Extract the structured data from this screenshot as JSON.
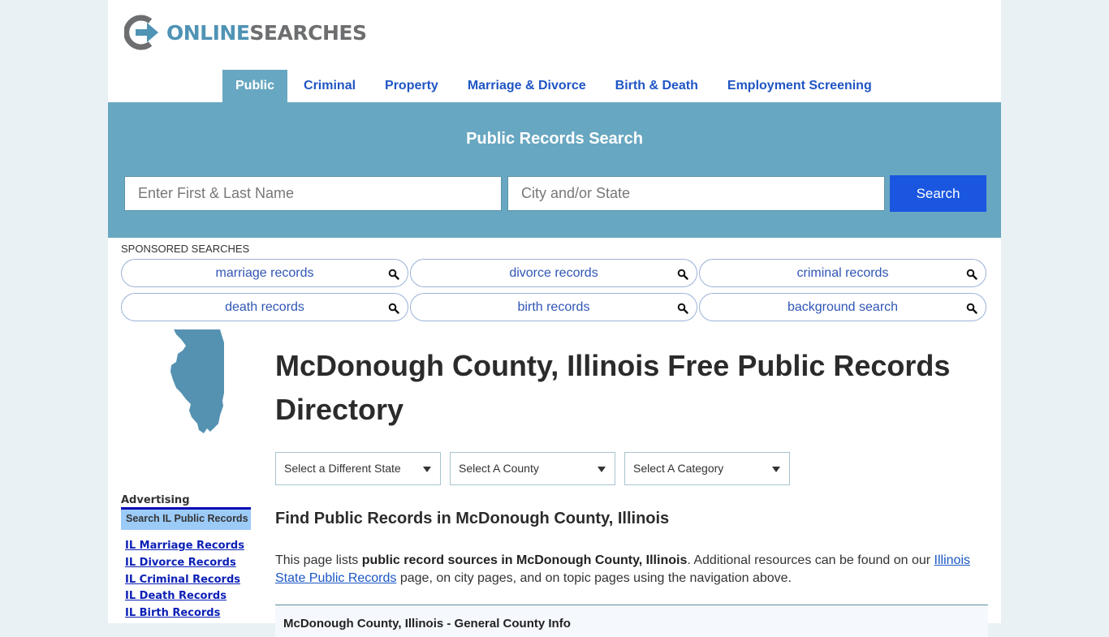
{
  "brand": {
    "name_part1": "ONLINE",
    "name_part2": "SEARCHES",
    "colors": {
      "primary": "#4f93b5",
      "secondary": "#6d6e70"
    }
  },
  "nav": {
    "items": [
      {
        "label": "Public",
        "active": true
      },
      {
        "label": "Criminal",
        "active": false
      },
      {
        "label": "Property",
        "active": false
      },
      {
        "label": "Marriage & Divorce",
        "active": false
      },
      {
        "label": "Birth & Death",
        "active": false
      },
      {
        "label": "Employment Screening",
        "active": false
      }
    ]
  },
  "search": {
    "title": "Public Records Search",
    "name_placeholder": "Enter First & Last Name",
    "name_value": "",
    "city_placeholder": "City and/or State",
    "city_value": "",
    "button_label": "Search",
    "band_color": "#68a7c1",
    "button_color": "#1a56e0"
  },
  "sponsored": {
    "label": "SPONSORED SEARCHES",
    "items": [
      {
        "label": "marriage records",
        "icon": "search-icon"
      },
      {
        "label": "divorce records",
        "icon": "search-icon"
      },
      {
        "label": "criminal records",
        "icon": "search-icon"
      },
      {
        "label": "death records",
        "icon": "search-icon"
      },
      {
        "label": "birth records",
        "icon": "search-icon"
      },
      {
        "label": "background search",
        "icon": "search-icon"
      }
    ]
  },
  "sidebar": {
    "state_map_icon": "illinois-map-icon",
    "ad_label": "Advertising",
    "ad_box_title": "Search IL Public Records",
    "ad_links": [
      "IL Marriage Records",
      "IL Divorce Records",
      "IL Criminal Records",
      "IL Death Records",
      "IL Birth Records"
    ]
  },
  "main": {
    "title": "McDonough County, Illinois Free Public Records Directory",
    "selects": [
      {
        "selected": "Select a Different State"
      },
      {
        "selected": "Select A County"
      },
      {
        "selected": "Select A Category"
      }
    ],
    "section_title": "Find Public Records in McDonough County, Illinois",
    "intro": {
      "part1": "This page lists ",
      "bold": "public record sources in McDonough County, Illinois",
      "part2": ". Additional resources can be found on our ",
      "link": "Illinois State Public Records",
      "part3": " page, on city pages, and on topic pages using the navigation above."
    },
    "info_box_title": "McDonough County, Illinois - General County Info"
  }
}
